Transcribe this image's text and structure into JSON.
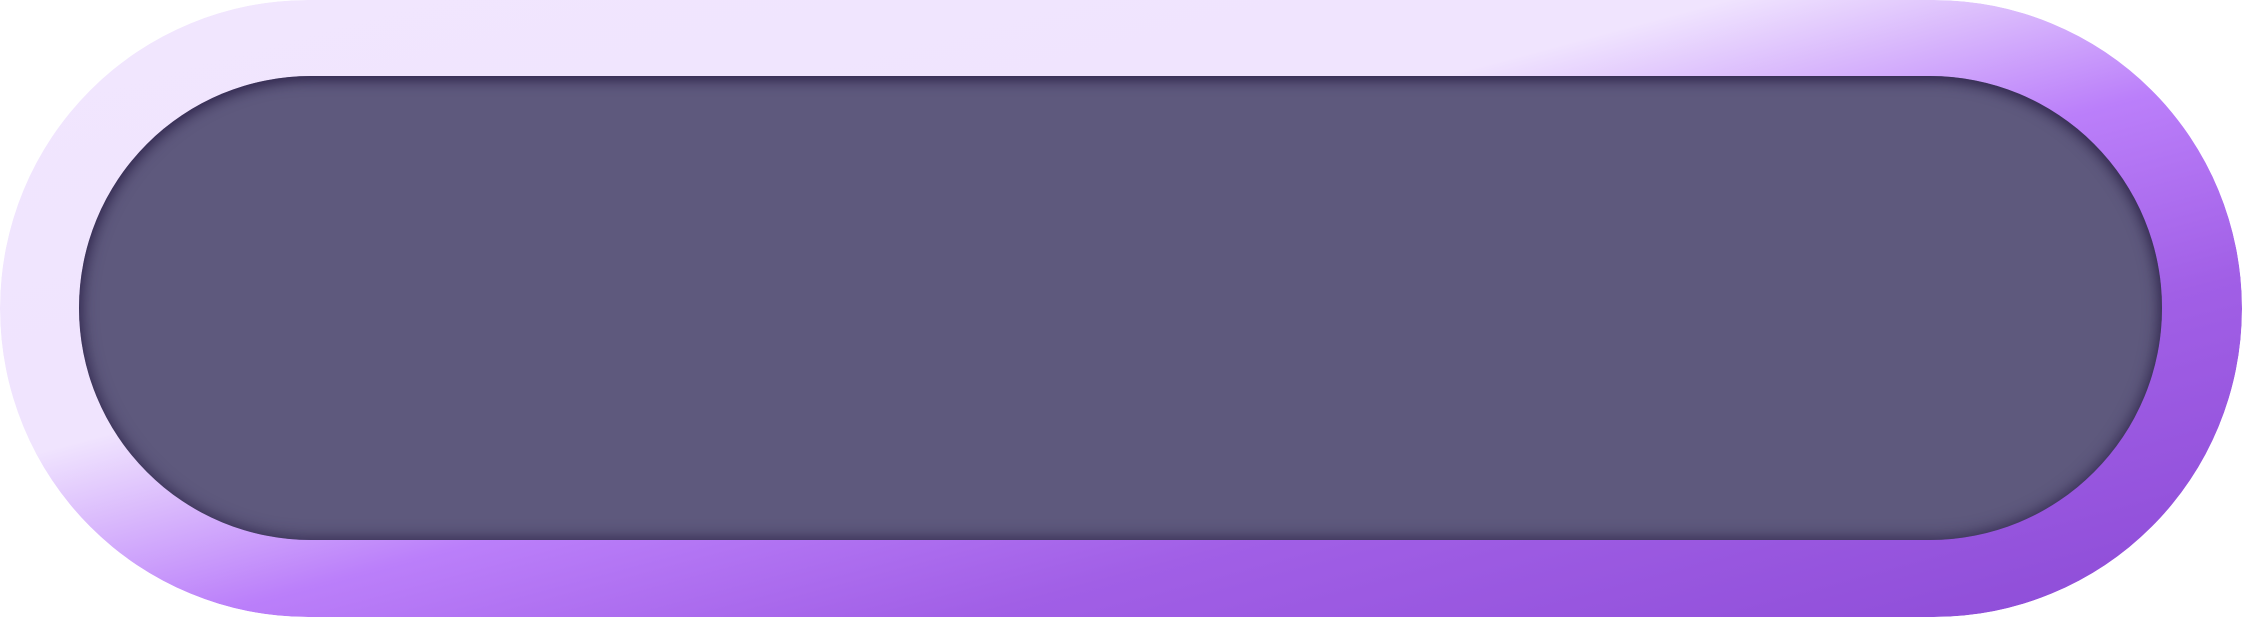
{
  "button": {
    "label": "",
    "colors": {
      "frame_gradient": [
        "#f1e6fe",
        "#f0e4fe",
        "#bb7ffa",
        "#a15fe6",
        "#8c4bd6"
      ],
      "face": "#5e597d"
    }
  }
}
